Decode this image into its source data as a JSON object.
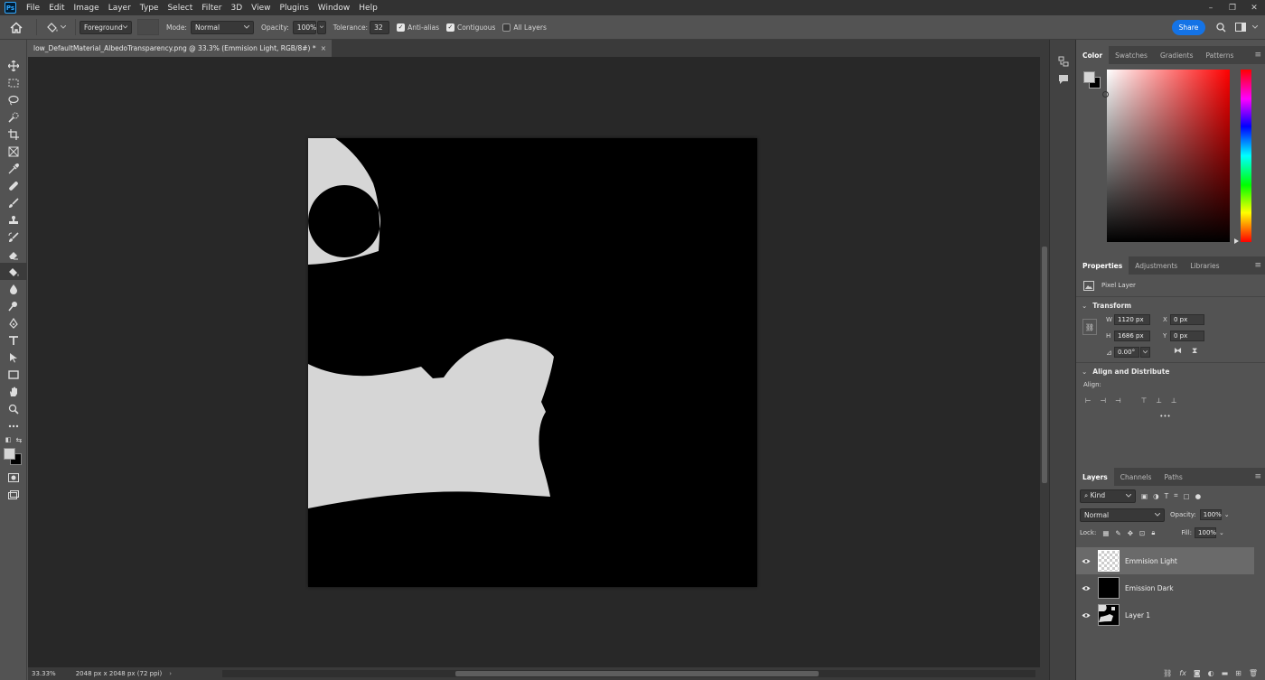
{
  "app": {
    "logo": "Ps"
  },
  "menu": [
    "File",
    "Edit",
    "Image",
    "Layer",
    "Type",
    "Select",
    "Filter",
    "3D",
    "View",
    "Plugins",
    "Window",
    "Help"
  ],
  "window_controls": [
    "–",
    "❐",
    "✕"
  ],
  "options": {
    "fill_source": "Foreground",
    "mode_label": "Mode:",
    "mode_value": "Normal",
    "opacity_label": "Opacity:",
    "opacity_value": "100%",
    "tolerance_label": "Tolerance:",
    "tolerance_value": "32",
    "antialias_label": "Anti-alias",
    "contiguous_label": "Contiguous",
    "all_layers_label": "All Layers",
    "antialias_checked": true,
    "contiguous_checked": true,
    "all_layers_checked": false,
    "share_label": "Share"
  },
  "document": {
    "tab_title": "low_DefaultMaterial_AlbedoTransparency.png @ 33.3% (Emmision Light, RGB/8#) *",
    "close": "×",
    "canvas_bg": "#000000",
    "shape_color": "#d6d6d6"
  },
  "status": {
    "zoom": "33.33%",
    "dimensions": "2048 px x 2048 px (72 ppi)"
  },
  "color_panel": {
    "tabs": [
      "Color",
      "Swatches",
      "Gradients",
      "Patterns"
    ],
    "foreground": "#d6d6d6",
    "background": "#000000"
  },
  "properties": {
    "tabs": [
      "Properties",
      "Adjustments",
      "Libraries"
    ],
    "kind": "Pixel Layer",
    "transform_title": "Transform",
    "w_label": "W",
    "w_value": "1120 px",
    "h_label": "H",
    "h_value": "1686 px",
    "x_label": "X",
    "x_value": "0 px",
    "y_label": "Y",
    "y_value": "0 px",
    "angle_value": "0.00°",
    "align_title": "Align and Distribute",
    "align_label": "Align:",
    "more": "•••"
  },
  "layers_panel": {
    "tabs": [
      "Layers",
      "Channels",
      "Paths"
    ],
    "filter_label": "Kind",
    "blend_mode": "Normal",
    "opacity_label": "Opacity:",
    "opacity_value": "100%",
    "lock_label": "Lock:",
    "fill_label": "Fill:",
    "fill_value": "100%",
    "layers": [
      {
        "name": "Emmision Light",
        "selected": true
      },
      {
        "name": "Emission Dark",
        "selected": false
      },
      {
        "name": "Layer 1",
        "selected": false
      }
    ]
  }
}
